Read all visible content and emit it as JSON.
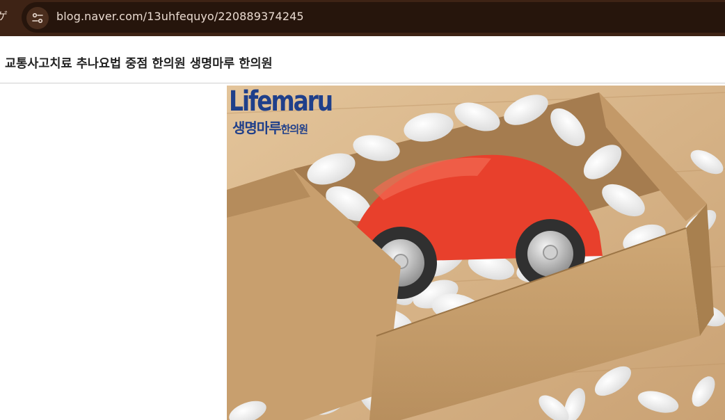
{
  "browser": {
    "url": "blog.naver.com/13uhfequyo/220889374245",
    "edge_glyph": "ゲ"
  },
  "post": {
    "title": "교통사고치료 추나요법 중점 한의원 생명마루 한의원"
  },
  "image": {
    "logo_latin": "Lifemaru",
    "logo_korean_main": "생명마루",
    "logo_korean_sub": "한의원"
  },
  "colors": {
    "toolbar": "#3e2315",
    "url_field": "#26150c",
    "logo": "#1f3f8a",
    "car": "#e8402c"
  }
}
